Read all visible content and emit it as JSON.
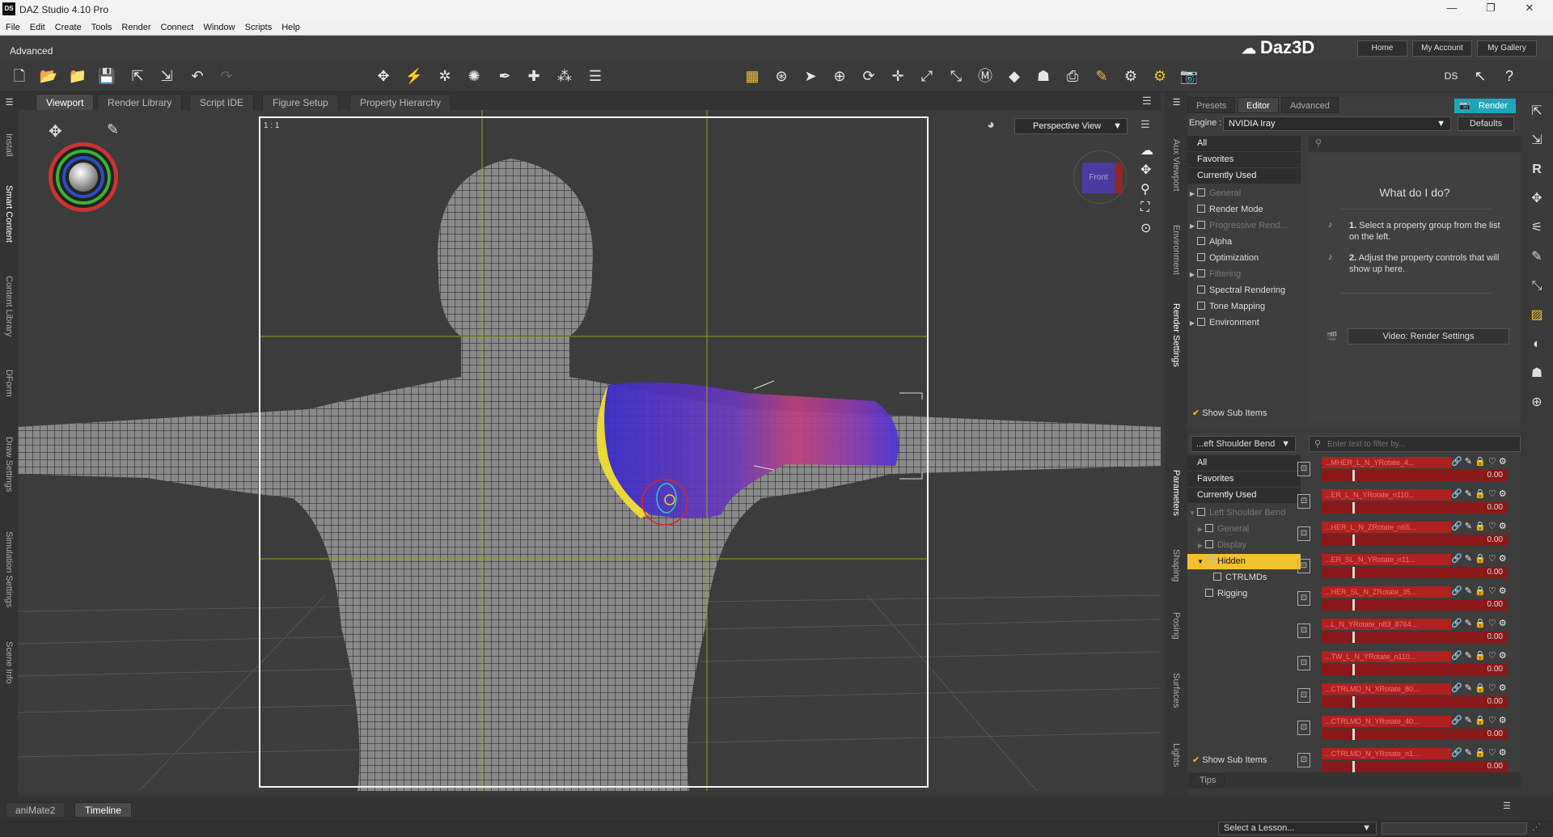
{
  "window": {
    "title": "DAZ Studio 4.10 Pro",
    "app_icon": "DS"
  },
  "menu": [
    "File",
    "Edit",
    "Create",
    "Tools",
    "Render",
    "Connect",
    "Window",
    "Scripts",
    "Help"
  ],
  "layout_label": "Advanced",
  "brand": "Daz3D",
  "top_links": [
    "Home",
    "My Account",
    "My Gallery"
  ],
  "left_tabs": [
    "Install",
    "Smart Content",
    "Content Library",
    "DForm",
    "Draw Settings",
    "Simulation Settings",
    "Scene Info"
  ],
  "viewport_tabs": [
    "Viewport",
    "Render Library",
    "Script IDE",
    "Figure Setup",
    "Property Hierarchy"
  ],
  "viewport": {
    "ratio_label": "1 : 1",
    "view_select": "Perspective View",
    "cube_label": "Front"
  },
  "mid_tabs": [
    "Aux Viewport",
    "Environment",
    "Render Settings",
    "Parameters",
    "Shaping",
    "Posing",
    "Surfaces",
    "Lights"
  ],
  "render_panel": {
    "tabs": [
      "Presets",
      "Editor",
      "Advanced"
    ],
    "render_button": "Render",
    "engine_label": "Engine :",
    "engine": "NVIDIA Iray",
    "defaults_button": "Defaults",
    "filters": [
      "All",
      "Favorites",
      "Currently Used"
    ],
    "groups": [
      {
        "label": "General",
        "dim": true,
        "expander": true
      },
      {
        "label": "Render Mode",
        "dim": false,
        "expander": false
      },
      {
        "label": "Progressive Rend...",
        "dim": true,
        "expander": true
      },
      {
        "label": "Alpha",
        "dim": false,
        "expander": false
      },
      {
        "label": "Optimization",
        "dim": false,
        "expander": false
      },
      {
        "label": "Filtering",
        "dim": true,
        "expander": true
      },
      {
        "label": "Spectral Rendering",
        "dim": false,
        "expander": false
      },
      {
        "label": "Tone Mapping",
        "dim": false,
        "expander": false
      },
      {
        "label": "Environment",
        "dim": false,
        "expander": true
      }
    ],
    "show_sub_items": "Show Sub Items",
    "help_title": "What do I do?",
    "help_steps": [
      {
        "num": "1.",
        "text": "Select a property group from the list on the left."
      },
      {
        "num": "2.",
        "text": "Adjust the property controls that will show up here."
      }
    ],
    "video_button": "Video: Render Settings"
  },
  "params_panel": {
    "node_select": "...eft Shoulder Bend",
    "filter_placeholder": "Enter text to filter by...",
    "filters": [
      "All",
      "Favorites",
      "Currently Used"
    ],
    "tree": [
      {
        "label": "Left Shoulder Bend",
        "dim": true,
        "indent": 0,
        "sel": false,
        "exp": "▼"
      },
      {
        "label": "General",
        "dim": true,
        "indent": 1,
        "sel": false,
        "exp": "▶"
      },
      {
        "label": "Display",
        "dim": true,
        "indent": 1,
        "sel": false,
        "exp": "▶"
      },
      {
        "label": "Hidden",
        "dim": false,
        "indent": 1,
        "sel": true,
        "exp": "▼"
      },
      {
        "label": "CTRLMDs",
        "dim": false,
        "indent": 2,
        "sel": false,
        "exp": ""
      },
      {
        "label": "Rigging",
        "dim": false,
        "indent": 1,
        "sel": false,
        "exp": ""
      }
    ],
    "show_sub_items": "Show Sub Items",
    "sliders": [
      {
        "name": "...MHER_L_N_YRotate_4...",
        "value": "0.00"
      },
      {
        "name": "...ER_L_N_YRotate_n110...",
        "value": "0.00"
      },
      {
        "name": "...HER_L_N_ZRotate_n65...",
        "value": "0.00"
      },
      {
        "name": "...ER_SL_N_YRotate_n11...",
        "value": "0.00"
      },
      {
        "name": "...HER_SL_N_ZRotate_35...",
        "value": "0.00"
      },
      {
        "name": "...L_N_YRotate_n83_8764...",
        "value": "0.00"
      },
      {
        "name": "...TW_L_N_YRotate_n110...",
        "value": "0.00"
      },
      {
        "name": "...CTRLMD_N_XRotate_80...",
        "value": "0.00"
      },
      {
        "name": "...CTRLMD_N_YRotate_40...",
        "value": "0.00"
      },
      {
        "name": "...CTRLMD_N_YRotate_n1...",
        "value": "0.00"
      }
    ],
    "tips_tab": "Tips"
  },
  "bottom_tabs": [
    "aniMate2",
    "Timeline"
  ],
  "lesson_select": "Select a Lesson..."
}
